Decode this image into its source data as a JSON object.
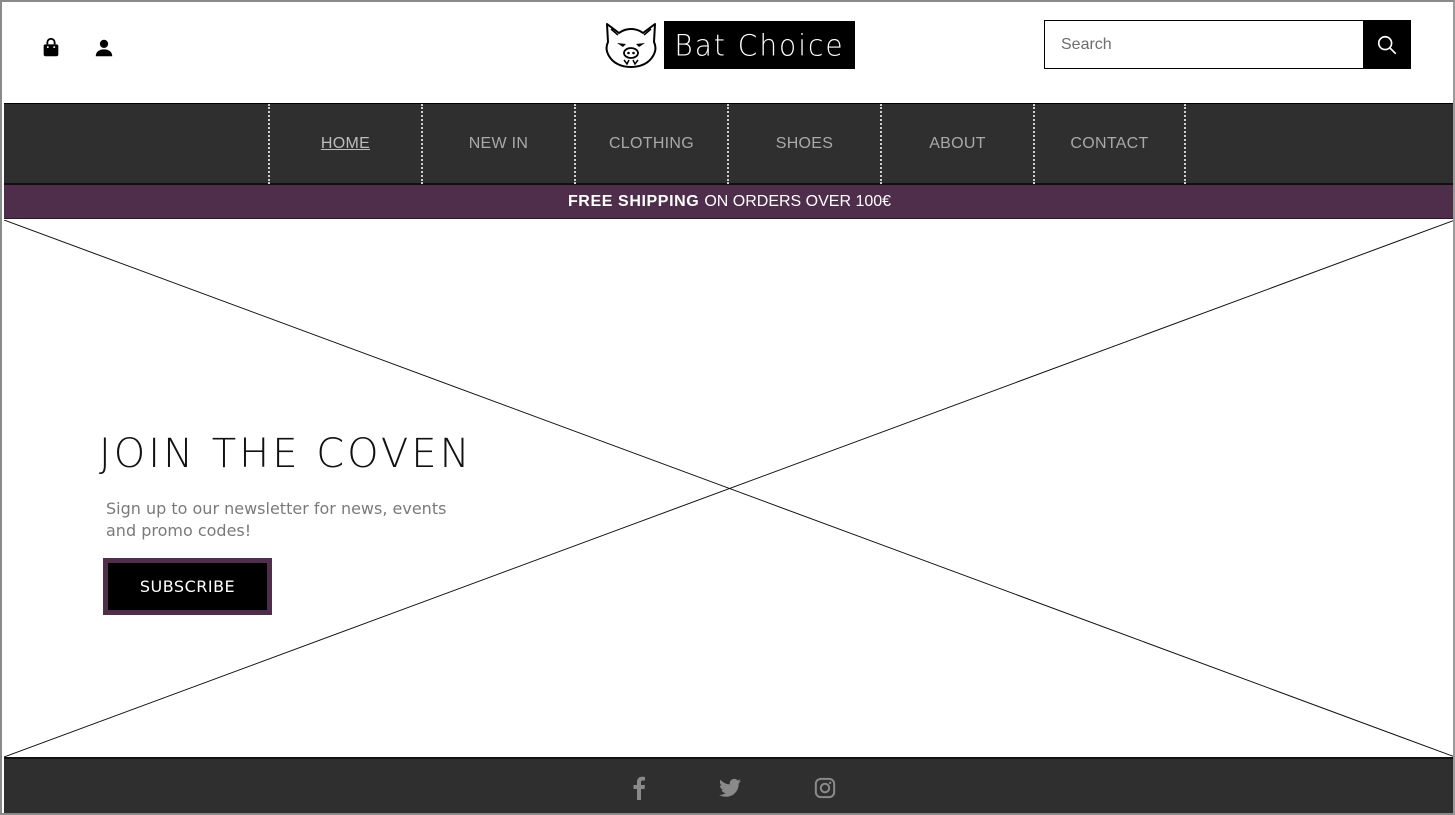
{
  "header": {
    "cart_icon": "shopping-bag-icon",
    "account_icon": "user-icon",
    "logo_text": "Bat Choice",
    "search": {
      "placeholder": "Search",
      "value": "",
      "icon": "search-icon"
    }
  },
  "nav": {
    "items": [
      {
        "label": "HOME",
        "active": true
      },
      {
        "label": "NEW IN",
        "active": false
      },
      {
        "label": "CLOTHING",
        "active": false
      },
      {
        "label": "SHOES",
        "active": false
      },
      {
        "label": "ABOUT",
        "active": false
      },
      {
        "label": "CONTACT",
        "active": false
      }
    ]
  },
  "promo": {
    "strong": "FREE SHIPPING",
    "rest": "ON ORDERS OVER 100€"
  },
  "hero": {
    "title": "JOIN THE COVEN",
    "text": "Sign up to our newsletter for news, events and promo codes!",
    "button": "SUBSCRIBE"
  },
  "footer": {
    "social": [
      "facebook-icon",
      "twitter-icon",
      "instagram-icon"
    ]
  },
  "colors": {
    "nav_bg": "#2f2f2f",
    "accent": "#4f2e4c",
    "black": "#000000"
  }
}
